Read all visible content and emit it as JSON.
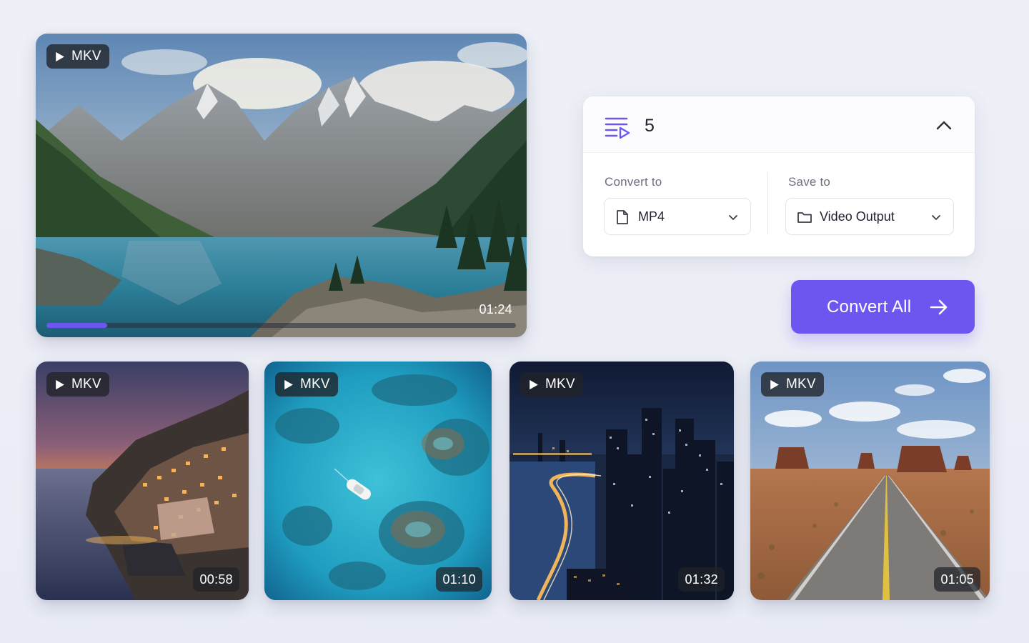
{
  "hero": {
    "format_badge": "MKV",
    "duration": "01:24",
    "progress_fraction": 0.13,
    "scene": "mountain lake"
  },
  "thumbnails": [
    {
      "format_badge": "MKV",
      "duration": "00:58",
      "scene": "coastal village at sunset"
    },
    {
      "format_badge": "MKV",
      "duration": "01:10",
      "scene": "boat over coral reef"
    },
    {
      "format_badge": "MKV",
      "duration": "01:32",
      "scene": "city skyline at night"
    },
    {
      "format_badge": "MKV",
      "duration": "01:05",
      "scene": "desert road"
    }
  ],
  "panel": {
    "queue_count": "5",
    "queue_icon": "playlist-play-icon",
    "collapse_icon": "chevron-up-icon",
    "convert_to": {
      "label": "Convert to",
      "value": "MP4",
      "icon": "file-icon"
    },
    "save_to": {
      "label": "Save to",
      "value": "Video Output",
      "icon": "folder-icon"
    }
  },
  "convert_button": {
    "label": "Convert All",
    "icon": "arrow-right-icon"
  },
  "colors": {
    "accent": "#6b56f0",
    "background": "#eceef6",
    "panel": "#ffffff",
    "badge": "#202228"
  }
}
